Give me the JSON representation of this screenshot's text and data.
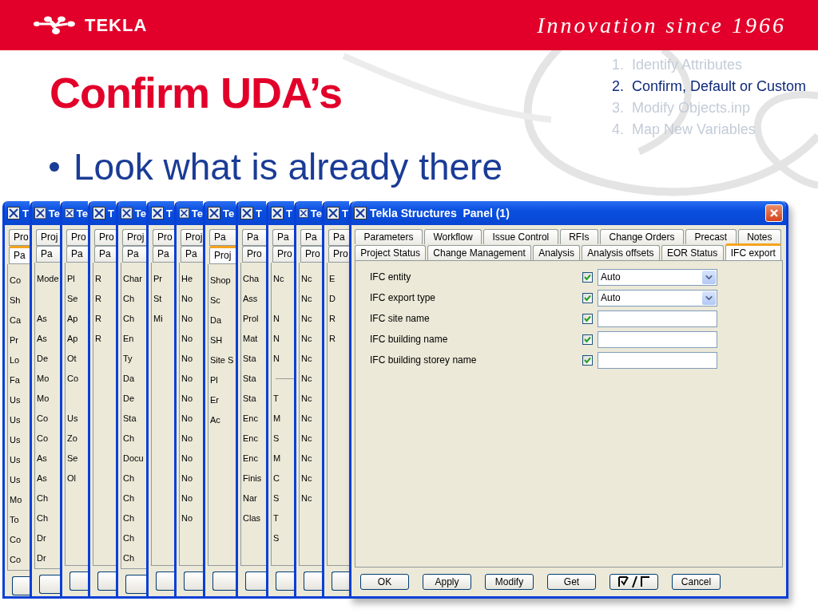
{
  "header": {
    "logo": "TEKLA",
    "tagline": "Innovation since 1966"
  },
  "title": "Confirm UDA’s",
  "bullets": [
    "Look what is already there"
  ],
  "steps": [
    {
      "number": "1.",
      "text": "Identify Attributes",
      "selected": false
    },
    {
      "number": "2.",
      "text": "Confirm, Default or Custom",
      "selected": true
    },
    {
      "number": "3.",
      "text": "Modify Objects.inp",
      "selected": false
    },
    {
      "number": "4.",
      "text": "Map New Variables",
      "selected": false
    }
  ],
  "windows_behind": [
    {
      "title": "T",
      "tab_top": "Pro",
      "tab_bottom": {
        "label": "Pa",
        "selected": true
      },
      "rows": [
        {
          "kind": "label",
          "text": "Co"
        },
        {
          "kind": "label",
          "text": "Sh"
        },
        {
          "kind": "label",
          "text": "Ca"
        },
        {
          "kind": "label",
          "text": "Pr"
        },
        {
          "kind": "label",
          "text": "Lo"
        },
        {
          "kind": "label",
          "text": "Fa"
        },
        {
          "kind": "label",
          "text": "Us"
        },
        {
          "kind": "label",
          "text": "Us"
        },
        {
          "kind": "label",
          "text": "Us"
        },
        {
          "kind": "label",
          "text": "Us"
        },
        {
          "kind": "label",
          "text": "Us"
        },
        {
          "kind": "label",
          "text": "Mo"
        },
        {
          "kind": "label",
          "text": "To"
        },
        {
          "kind": "label",
          "text": "Co"
        },
        {
          "kind": "label",
          "text": "Co"
        }
      ]
    },
    {
      "title": "Te",
      "tab_top": "Proj",
      "tab_bottom": {
        "label": "Pa",
        "selected": false
      },
      "rows": [
        {
          "kind": "label",
          "text": "Mode"
        },
        {
          "kind": "blank"
        },
        {
          "kind": "label",
          "text": "As"
        },
        {
          "kind": "label",
          "text": "As"
        },
        {
          "kind": "label",
          "text": "De"
        },
        {
          "kind": "label",
          "text": "Mo"
        },
        {
          "kind": "label",
          "text": "Mo"
        },
        {
          "kind": "label",
          "text": "Co"
        },
        {
          "kind": "label",
          "text": "Co"
        },
        {
          "kind": "label",
          "text": "As"
        },
        {
          "kind": "label",
          "text": "As"
        },
        {
          "kind": "label",
          "text": "Ch"
        },
        {
          "kind": "label",
          "text": "Ch"
        },
        {
          "kind": "label",
          "text": "Dr"
        },
        {
          "kind": "label",
          "text": "Dr"
        }
      ]
    },
    {
      "title": "Te",
      "tab_top": "Pro",
      "tab_bottom": {
        "label": "Pa",
        "selected": false
      },
      "rows": [
        {
          "kind": "label",
          "text": "Pl"
        },
        {
          "kind": "label",
          "text": "Se"
        },
        {
          "kind": "label",
          "text": "Ap"
        },
        {
          "kind": "label",
          "text": "Ap"
        },
        {
          "kind": "label",
          "text": "Ot"
        },
        {
          "kind": "label",
          "text": "Co"
        },
        {
          "kind": "blank"
        },
        {
          "kind": "label",
          "text": "Us"
        },
        {
          "kind": "label",
          "text": "Zo"
        },
        {
          "kind": "label",
          "text": "Se"
        },
        {
          "kind": "label",
          "text": "Ol"
        }
      ]
    },
    {
      "title": "T",
      "tab_top": "Pro",
      "tab_bottom": {
        "label": "Pa",
        "selected": false
      },
      "rows": [
        {
          "kind": "label",
          "text": "R"
        },
        {
          "kind": "label",
          "text": "R"
        },
        {
          "kind": "label",
          "text": "R"
        },
        {
          "kind": "label",
          "text": "R"
        }
      ]
    },
    {
      "title": "Te",
      "tab_top": "Proj",
      "tab_bottom": {
        "label": "Pa",
        "selected": false
      },
      "rows": [
        {
          "kind": "label",
          "text": "Char"
        },
        {
          "kind": "label",
          "text": "Ch"
        },
        {
          "kind": "label",
          "text": "Ch"
        },
        {
          "kind": "label",
          "text": "En"
        },
        {
          "kind": "label",
          "text": "Ty"
        },
        {
          "kind": "label",
          "text": "Da"
        },
        {
          "kind": "label",
          "text": "De"
        },
        {
          "kind": "label",
          "text": "Sta"
        },
        {
          "kind": "label",
          "text": "Ch"
        },
        {
          "kind": "label",
          "text": "Docu"
        },
        {
          "kind": "label",
          "text": "Ch"
        },
        {
          "kind": "label",
          "text": "Ch"
        },
        {
          "kind": "label",
          "text": "Ch"
        },
        {
          "kind": "label",
          "text": "Ch"
        },
        {
          "kind": "label",
          "text": "Ch"
        }
      ]
    },
    {
      "title": "T",
      "tab_top": "Pro",
      "tab_bottom": {
        "label": "Pa",
        "selected": false
      },
      "rows": [
        {
          "kind": "label",
          "text": "Pr"
        },
        {
          "kind": "label",
          "text": "St"
        },
        {
          "kind": "label",
          "text": "Mi"
        }
      ]
    },
    {
      "title": "Te",
      "tab_top": "Proj",
      "tab_bottom": {
        "label": "Pa",
        "selected": false
      },
      "rows": [
        {
          "kind": "label",
          "text": "He"
        },
        {
          "kind": "label",
          "text": "No"
        },
        {
          "kind": "label",
          "text": "No"
        },
        {
          "kind": "label",
          "text": "No"
        },
        {
          "kind": "label",
          "text": "No"
        },
        {
          "kind": "label",
          "text": "No"
        },
        {
          "kind": "label",
          "text": "No"
        },
        {
          "kind": "label",
          "text": "No"
        },
        {
          "kind": "label",
          "text": "No"
        },
        {
          "kind": "label",
          "text": "No"
        },
        {
          "kind": "label",
          "text": "No"
        },
        {
          "kind": "label",
          "text": "No"
        },
        {
          "kind": "label",
          "text": "No"
        }
      ]
    },
    {
      "title": "Te",
      "tab_top": "Pa",
      "tab_bottom": {
        "label": "Proj",
        "selected": true
      },
      "rows": [
        {
          "kind": "label",
          "text": "Shop"
        },
        {
          "kind": "label",
          "text": "Sc"
        },
        {
          "kind": "label",
          "text": "Da"
        },
        {
          "kind": "label",
          "text": "SH"
        },
        {
          "kind": "label",
          "text": "Site S"
        },
        {
          "kind": "label",
          "text": "Pl"
        },
        {
          "kind": "label",
          "text": "Er"
        },
        {
          "kind": "label",
          "text": "Ac"
        }
      ]
    },
    {
      "title": "T",
      "tab_top": "Pa",
      "tab_bottom": {
        "label": "Pro",
        "selected": false
      },
      "rows": [
        {
          "kind": "label",
          "text": "Cha"
        },
        {
          "kind": "label",
          "text": "Ass"
        },
        {
          "kind": "label",
          "text": "Prol"
        },
        {
          "kind": "label",
          "text": "Mat"
        },
        {
          "kind": "label",
          "text": "Sta"
        },
        {
          "kind": "label",
          "text": "Sta"
        },
        {
          "kind": "label",
          "text": "Sta"
        },
        {
          "kind": "label",
          "text": "Enc"
        },
        {
          "kind": "label",
          "text": "Enc"
        },
        {
          "kind": "label",
          "text": "Enc"
        },
        {
          "kind": "label",
          "text": "Finis"
        },
        {
          "kind": "label",
          "text": "Nar"
        },
        {
          "kind": "label",
          "text": "Clas"
        }
      ]
    },
    {
      "title": "T",
      "tab_top": "Pa",
      "tab_bottom": {
        "label": "Pro",
        "selected": false
      },
      "rows": [
        {
          "kind": "label",
          "text": "Nc"
        },
        {
          "kind": "blank"
        },
        {
          "kind": "label",
          "text": "N"
        },
        {
          "kind": "label",
          "text": "N"
        },
        {
          "kind": "label",
          "text": "N"
        },
        {
          "kind": "divider"
        },
        {
          "kind": "label",
          "text": "T"
        },
        {
          "kind": "label",
          "text": "M"
        },
        {
          "kind": "label",
          "text": "S"
        },
        {
          "kind": "label",
          "text": "M"
        },
        {
          "kind": "label",
          "text": "C"
        },
        {
          "kind": "label",
          "text": "S"
        },
        {
          "kind": "label",
          "text": "T"
        },
        {
          "kind": "label",
          "text": "S"
        }
      ]
    },
    {
      "title": "Te",
      "tab_top": "Pa",
      "tab_bottom": {
        "label": "Pro",
        "selected": false
      },
      "rows": [
        {
          "kind": "label",
          "text": "Nc"
        },
        {
          "kind": "label",
          "text": "Nc"
        },
        {
          "kind": "label",
          "text": "Nc"
        },
        {
          "kind": "label",
          "text": "Nc"
        },
        {
          "kind": "label",
          "text": "Nc"
        },
        {
          "kind": "label",
          "text": "Nc"
        },
        {
          "kind": "label",
          "text": "Nc"
        },
        {
          "kind": "label",
          "text": "Nc"
        },
        {
          "kind": "label",
          "text": "Nc"
        },
        {
          "kind": "label",
          "text": "Nc"
        },
        {
          "kind": "label",
          "text": "Nc"
        },
        {
          "kind": "label",
          "text": "Nc"
        }
      ]
    },
    {
      "title": "T",
      "tab_top": "Pa",
      "tab_bottom": {
        "label": "Pro",
        "selected": false
      },
      "rows": [
        {
          "kind": "label",
          "text": "E"
        },
        {
          "kind": "label",
          "text": "D"
        },
        {
          "kind": "label",
          "text": "R"
        },
        {
          "kind": "label",
          "text": "R"
        }
      ]
    }
  ],
  "window": {
    "title": "Tekla Structures  Panel (1)",
    "tab_rows": [
      [
        {
          "label": "Parameters",
          "selected": false
        },
        {
          "label": "Workflow",
          "selected": false
        },
        {
          "label": "Issue Control",
          "selected": false
        },
        {
          "label": "RFIs",
          "selected": false
        },
        {
          "label": "Change Orders",
          "selected": false
        },
        {
          "label": "Precast",
          "selected": false
        },
        {
          "label": "Notes",
          "selected": false
        }
      ],
      [
        {
          "label": "Project Status",
          "selected": false
        },
        {
          "label": "Change Management",
          "selected": false
        },
        {
          "label": "Analysis",
          "selected": false
        },
        {
          "label": "Analysis offsets",
          "selected": false
        },
        {
          "label": "EOR Status",
          "selected": false
        },
        {
          "label": "IFC export",
          "selected": true
        }
      ]
    ],
    "fields": [
      {
        "label": "IFC entity",
        "checked": true,
        "kind": "dropdown",
        "value": "Auto"
      },
      {
        "label": "IFC export type",
        "checked": true,
        "kind": "dropdown",
        "value": "Auto"
      },
      {
        "label": "IFC site name",
        "checked": true,
        "kind": "text"
      },
      {
        "label": "IFC building name",
        "checked": true,
        "kind": "text"
      },
      {
        "label": "IFC building storey name",
        "checked": true,
        "kind": "text"
      }
    ],
    "buttons": [
      {
        "kind": "text",
        "label": "OK"
      },
      {
        "kind": "text",
        "label": "Apply"
      },
      {
        "kind": "text",
        "label": "Modify"
      },
      {
        "kind": "text",
        "label": "Get"
      },
      {
        "kind": "toggle"
      },
      {
        "kind": "text",
        "label": "Cancel"
      }
    ]
  }
}
